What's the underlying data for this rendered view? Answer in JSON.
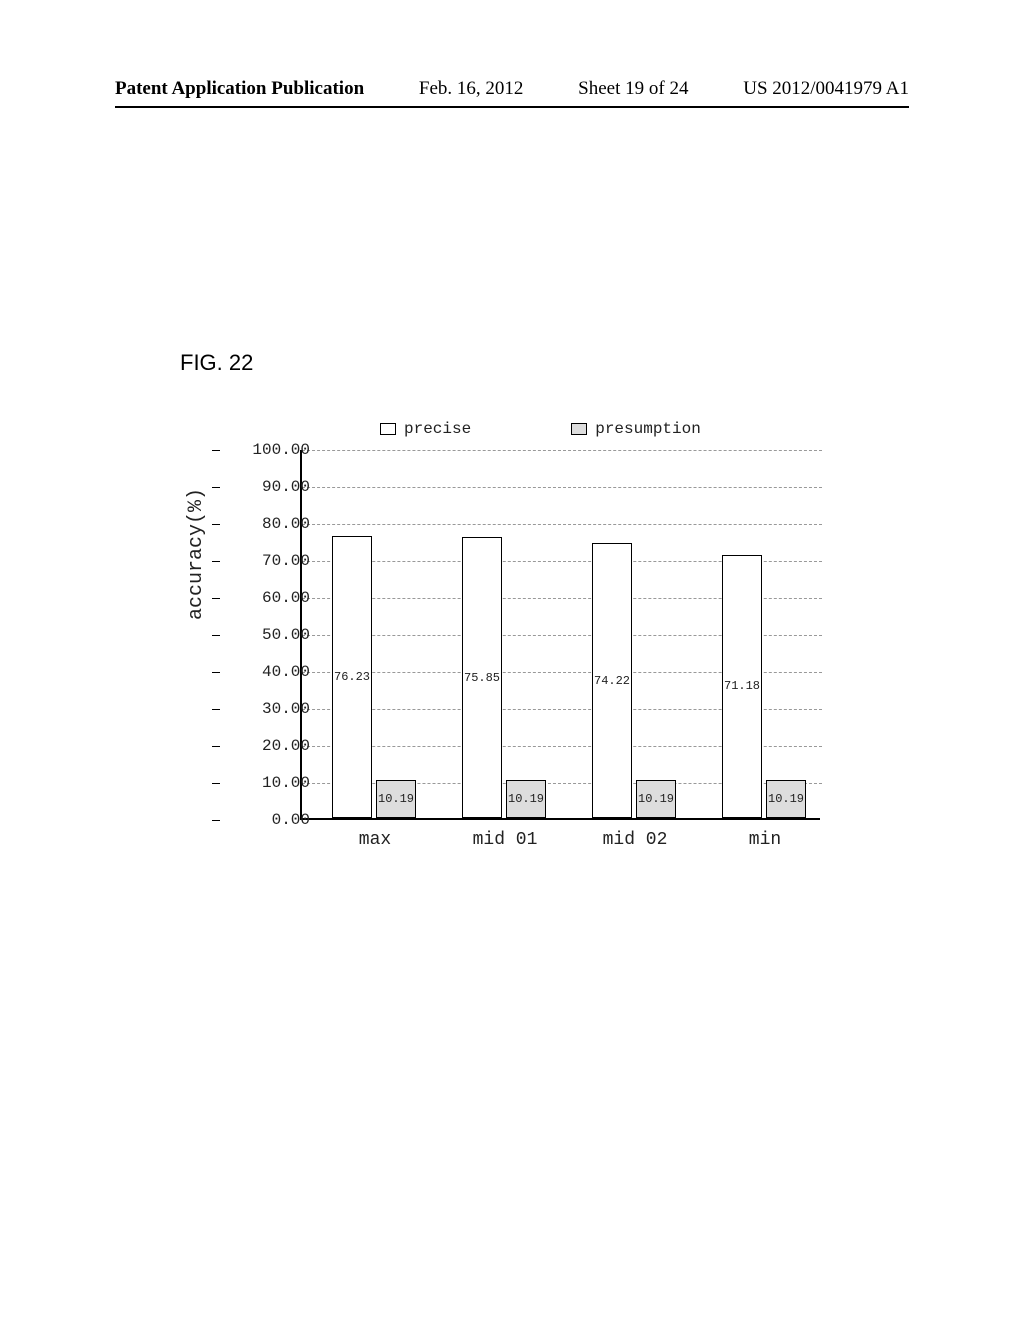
{
  "header": {
    "left": "Patent Application Publication",
    "date": "Feb. 16, 2012",
    "sheet": "Sheet 19 of 24",
    "pubno": "US 2012/0041979 A1"
  },
  "figure_label": "FIG. 22",
  "chart_data": {
    "type": "bar",
    "ylabel": "accuracy(%)",
    "xlabel": "",
    "ylim": [
      0,
      100
    ],
    "yticks": [
      0.0,
      10.0,
      20.0,
      30.0,
      40.0,
      50.0,
      60.0,
      70.0,
      80.0,
      90.0,
      100.0
    ],
    "categories": [
      "max",
      "mid 01",
      "mid 02",
      "min"
    ],
    "series": [
      {
        "name": "precise",
        "values": [
          76.23,
          75.85,
          74.22,
          71.18
        ]
      },
      {
        "name": "presumption",
        "values": [
          10.19,
          10.19,
          10.19,
          10.19
        ]
      }
    ],
    "legend_position": "top",
    "grid": true
  },
  "ytick_labels": [
    "0.00",
    "10.00",
    "20.00",
    "30.00",
    "40.00",
    "50.00",
    "60.00",
    "70.00",
    "80.00",
    "90.00",
    "100.00"
  ],
  "bar_value_labels": {
    "precise": [
      "76.23",
      "75.85",
      "74.22",
      "71.18"
    ],
    "presumption": [
      "10.19",
      "10.19",
      "10.19",
      "10.19"
    ]
  }
}
